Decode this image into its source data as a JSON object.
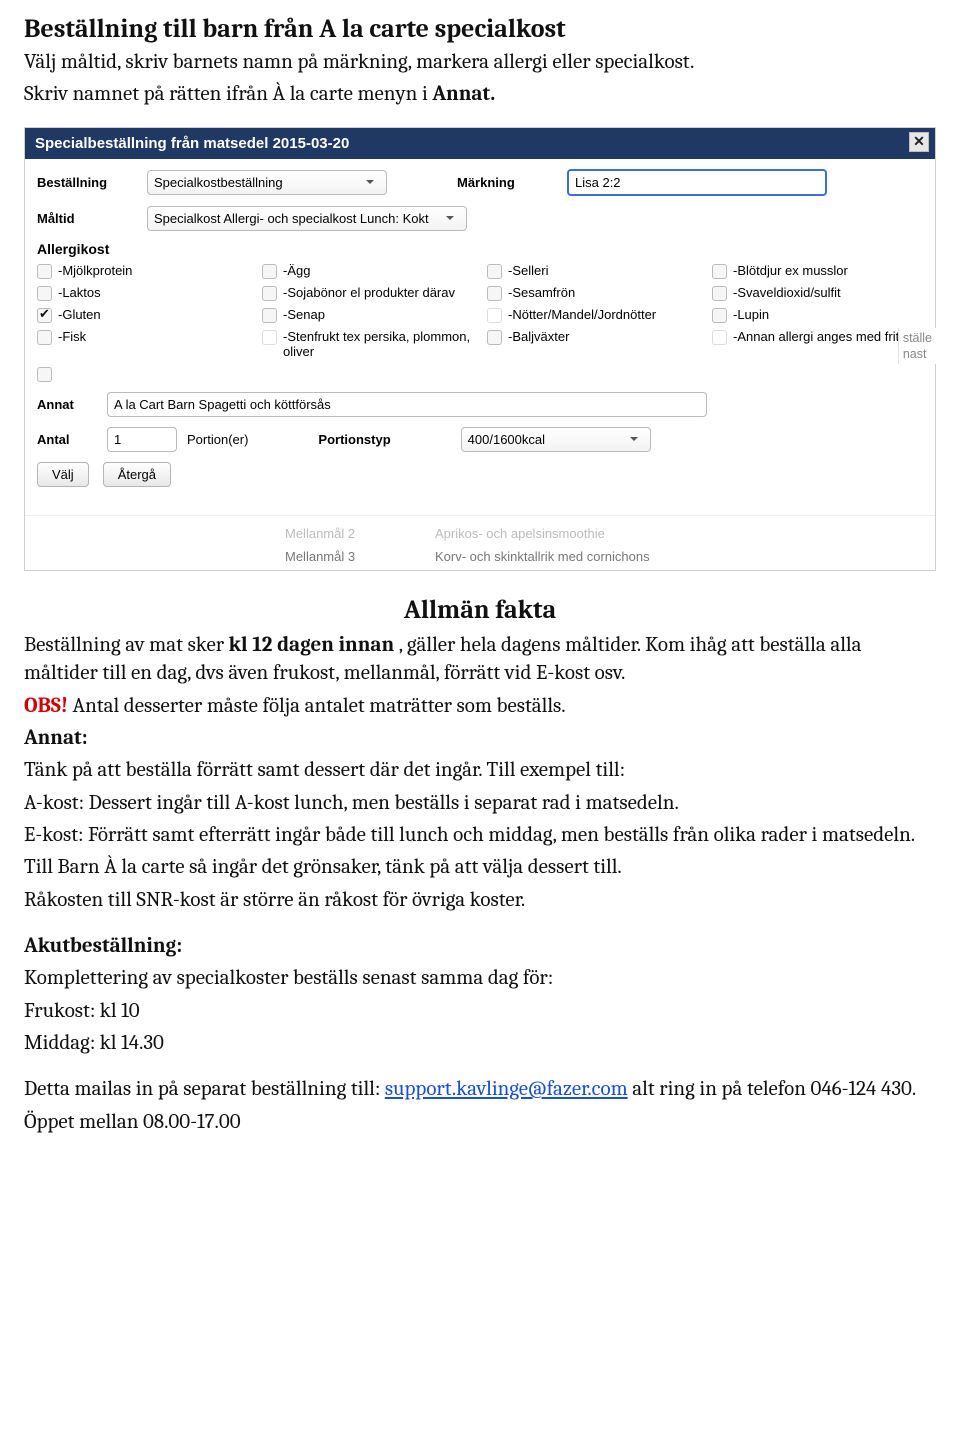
{
  "doc": {
    "title": "Beställning till barn från A la carte specialkost",
    "intro1": "Välj måltid, skriv barnets namn på märkning, markera allergi eller specialkost.",
    "intro2a": "Skriv namnet på rätten ifrån À la carte menyn i ",
    "intro2b_bold": "Annat.",
    "h2": "Allmän fakta",
    "p1a": "Beställning av mat sker ",
    "p1b_bold": "kl 12 dagen innan",
    "p1c": ", gäller hela dagens måltider. Kom ihåg att beställa alla måltider till en dag, dvs även frukost, mellanmål, förrätt vid E-kost osv.",
    "obs_label": "OBS!",
    "obs_text": " Antal desserter måste följa antalet maträtter som beställs.",
    "annat_label": "Annat:",
    "p2": "Tänk på att beställa förrätt samt dessert där det ingår. Till exempel till:",
    "p3": "A-kost: Dessert ingår till A-kost lunch, men beställs i separat rad i matsedeln.",
    "p4": "E-kost: Förrätt samt efterrätt ingår både till lunch och middag, men beställs från olika rader i matsedeln.",
    "p5": "Till Barn À la carte så ingår det grönsaker, tänk på att välja dessert till.",
    "p6": "Råkosten till SNR-kost är större än råkost för övriga koster.",
    "akut_h": "Akutbeställning:",
    "akut1": "Komplettering av specialkoster beställs senast samma dag för:",
    "akut2": "Frukost: kl 10",
    "akut3": "Middag: kl 14.30",
    "mail1": "Detta mailas in på separat beställning till: ",
    "mail_link": "support.kavlinge@fazer.com",
    "mail2": "  alt ring in på telefon 046-124 430.",
    "open": "Öppet mellan 08.00-17.00"
  },
  "dialog": {
    "title": "Specialbeställning från matsedel 2015-03-20",
    "close": "✕",
    "bestallning_label": "Beställning",
    "bestallning_value": "Specialkostbeställning",
    "markning_label": "Märkning",
    "markning_value": "Lisa 2:2",
    "maltid_label": "Måltid",
    "maltid_value": "Specialkost Allergi- och specialkost Lunch: Kokt",
    "allergi_title": "Allergikost",
    "checkboxes": {
      "r1c1": "-Mjölkprotein",
      "r1c2": "-Ägg",
      "r1c3": "-Selleri",
      "r1c4": "-Blötdjur ex musslor",
      "r2c1": "-Laktos",
      "r2c2": "-Sojabönor el produkter därav",
      "r2c3": "-Sesamfrön",
      "r2c4": "-Svaveldioxid/sulfit",
      "r3c1": "-Gluten",
      "r3c2": "-Senap",
      "r3c3": "-Nötter/Mandel/Jordnötter",
      "r3c4": "-Lupin",
      "r4c1": "-Fisk",
      "r4c2": "-Stenfrukt tex persika, plommon, oliver",
      "r4c3": "-Baljväxter",
      "r4c4": "-Annan allergi anges med fritext"
    },
    "annat_label": "Annat",
    "annat_value": "A la Cart Barn Spagetti och köttförsås",
    "antal_label": "Antal",
    "antal_value": "1",
    "portion_label": "Portion(er)",
    "portionstyp_label": "Portionstyp",
    "portionstyp_value": "400/1600kcal",
    "btn_valj": "Välj",
    "btn_aterga": "Återgå",
    "right_snip1": "ställe",
    "right_snip2": "nast",
    "behind": {
      "m2": "Mellanmål 2",
      "m2v": "Aprikos- och apelsinsmoothie",
      "m3": "Mellanmål 3",
      "m3v": "Korv- och skinktallrik med cornichons"
    }
  }
}
